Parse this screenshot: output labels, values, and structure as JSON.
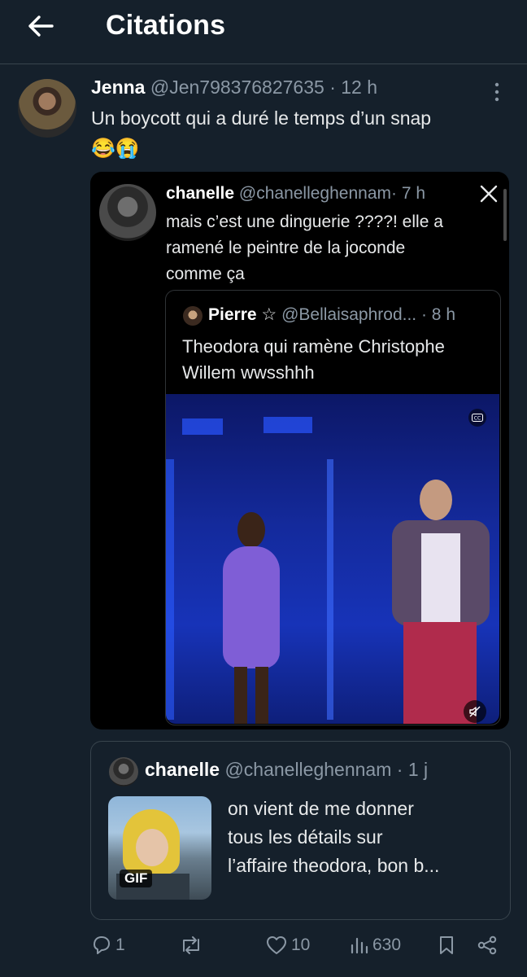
{
  "header": {
    "title": "Citations"
  },
  "tweet": {
    "name": "Jenna",
    "handle": "@Jen798376827635",
    "time": "· 12 h",
    "text": "Un boycott qui a duré le temps d’un snap",
    "emoji": "😂😭"
  },
  "quoted": {
    "name": "chanelle",
    "handle": "@chanelleghennam",
    "time": "· 7 h",
    "text_lines": [
      "mais c’est une dinguerie ????! elle a",
      "ramené le peintre de la joconde",
      "comme ça"
    ],
    "platform_icon": "x-logo-icon"
  },
  "nested": {
    "name": "Pierre",
    "star": "☆",
    "handle": "@Bellaisaphrod...",
    "time": "· 8 h",
    "text_lines": [
      "Theodora qui ramène Christophe",
      "Willem wwsshhh"
    ]
  },
  "second_quote": {
    "name": "chanelle",
    "handle": "@chanelleghennam",
    "time": "· 1 j",
    "text_lines": [
      "on vient de me donner",
      "tous les détails sur",
      "l’affaire theodora, bon b..."
    ],
    "gif_badge": "GIF"
  },
  "actions": {
    "replies": "1",
    "retweets": "",
    "likes": "10",
    "views": "630"
  },
  "colors": {
    "background": "#15202b",
    "text": "#e7e9ea",
    "muted": "#8b98a5",
    "border": "#38444d"
  }
}
